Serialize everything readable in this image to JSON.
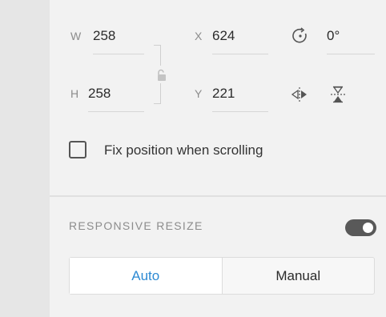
{
  "size": {
    "w_label": "W",
    "w_value": "258",
    "h_label": "H",
    "h_value": "258"
  },
  "position": {
    "x_label": "X",
    "x_value": "624",
    "y_label": "Y",
    "y_value": "221"
  },
  "rotation": {
    "value": "0°"
  },
  "fix_position": {
    "label": "Fix position when scrolling",
    "checked": false
  },
  "responsive": {
    "title": "RESPONSIVE RESIZE",
    "enabled": true,
    "options": [
      "Auto",
      "Manual"
    ],
    "selected": "Auto"
  },
  "colors": {
    "accent": "#2d8ad3",
    "toggle_on": "#595959"
  }
}
